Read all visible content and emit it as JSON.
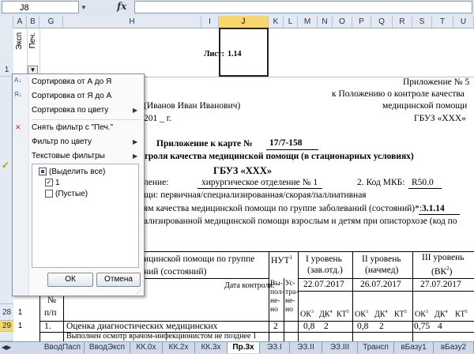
{
  "formula_bar": {
    "name_box": "J8",
    "fx": "fx",
    "formula": ""
  },
  "columns": [
    {
      "label": "A"
    },
    {
      "label": "B"
    },
    {
      "label": "G"
    },
    {
      "label": "H"
    },
    {
      "label": "I"
    },
    {
      "label": "J"
    },
    {
      "label": "K"
    },
    {
      "label": "L"
    },
    {
      "label": "M"
    },
    {
      "label": "N"
    },
    {
      "label": "O"
    },
    {
      "label": "P"
    },
    {
      "label": "Q"
    },
    {
      "label": "R"
    },
    {
      "label": "S"
    },
    {
      "label": "T"
    },
    {
      "label": "U"
    }
  ],
  "rows": [
    {
      "label": "1"
    },
    {
      "label": "28"
    },
    {
      "label": "29"
    }
  ],
  "row_col_a": {
    "label_1": "1",
    "label_28": "1",
    "label_29": "1"
  },
  "col_headers_vertical": {
    "a": "Эксп",
    "b": "Печ."
  },
  "cells": {
    "list": "Лист:",
    "list_num": "1.14",
    "app_no": "Приложение № 5",
    "k_polozh": "к Положению о контроле качества",
    "med_pom": "медицинской помощи",
    "fio": "(Иванов Иван Иванович)",
    "date": "201 _ г.",
    "gbuz_short": "ГБУЗ «XXX»",
    "app_karta": "Приложение к карте №",
    "karta_num": "17/7-158",
    "title": "троля качества медицинской помощи (в стационарных условиях)",
    "gbuz_title": "ГБУЗ «XXX»",
    "otdel_label": "ление:",
    "otdel_value": "хирургическое отделение № 1",
    "kod_label": "2.  Код МКБ:",
    "kod_value": "R50.0",
    "vid": "щи: первичная/специализированная/скорая/паллиативная",
    "group": "ям качества медицинской помощи по группе заболеваний (состояний)*:",
    "group_num": "3.1.14",
    "spec": "ализированной медицинской помощи взрослым и детям при описторхозе (код по",
    "tbl_head1": "ицинской помощи по группе",
    "tbl_head2": "ний (состояний)",
    "nut": "НУТ",
    "nut_sup": "1",
    "data_kontrol": "Дата контроля:",
    "vy": "Вы-",
    "pol": "пол-",
    "ne": "не-",
    "no": "но",
    "us": "Ус-",
    "tra": "тра-",
    "ne2": "не-",
    "no2": "но",
    "lvl1": "I уровень",
    "lvl1b": "(зав.отд.)",
    "lvl2": "II уровень",
    "lvl2b": "(начмед)",
    "lvl3": "III уровень",
    "lvl3b": "(ВК",
    "lvl3sup": "2",
    "lvl3c": ")",
    "date1": "22.07.2017",
    "date2": "26.07.2017",
    "date3": "27.07.2017",
    "ok": "ОК",
    "dk": "ДК",
    "kt": "КТ",
    "s3": "3",
    "s4": "4",
    "s5": "5",
    "num_label": "№",
    "pp_label": "п/п",
    "row29_num": "1.",
    "row29_text": "Оценка диагностических медицинских",
    "row29_nut": "2",
    "row29_ok1": "0,8",
    "row29_dk1": "2",
    "row29_ok2": "0,8",
    "row29_dk2": "2",
    "row29_ok3": "0,75",
    "row29_dk3": "4",
    "row30_text": "Выполнен осмотр врачом-инфекционистом не позднее 1"
  },
  "filter_menu": {
    "sort_asc": "Сортировка от А до Я",
    "sort_desc": "Сортировка от Я до А",
    "sort_color": "Сортировка по цвету",
    "clear_filter": "Снять фильтр с \"Печ.\"",
    "filter_color": "Фильтр по цвету",
    "text_filters": "Текстовые фильтры",
    "items": [
      {
        "label": "(Выделить все)",
        "state": "mixed"
      },
      {
        "label": "1",
        "state": "checked"
      },
      {
        "label": "(Пустые)",
        "state": "unchecked"
      }
    ],
    "ok": "ОК",
    "cancel": "Отмена"
  },
  "sheet_tabs": [
    {
      "label": "ВводПасп"
    },
    {
      "label": "ВводЭксп"
    },
    {
      "label": "КК.0х"
    },
    {
      "label": "КК.2х"
    },
    {
      "label": "КК.3х"
    },
    {
      "label": "Пр.3х"
    },
    {
      "label": "ЭЗ.I"
    },
    {
      "label": "ЭЗ.II"
    },
    {
      "label": "ЭЗ.III"
    },
    {
      "label": "Трансп"
    },
    {
      "label": "вБазу1"
    },
    {
      "label": "вБазу2"
    }
  ],
  "active_tab": "Пр.3х",
  "colors": {
    "selected_header": "#f7d66e",
    "header_bg": "#e4eaf3",
    "menu_bg": "#fafafa"
  }
}
